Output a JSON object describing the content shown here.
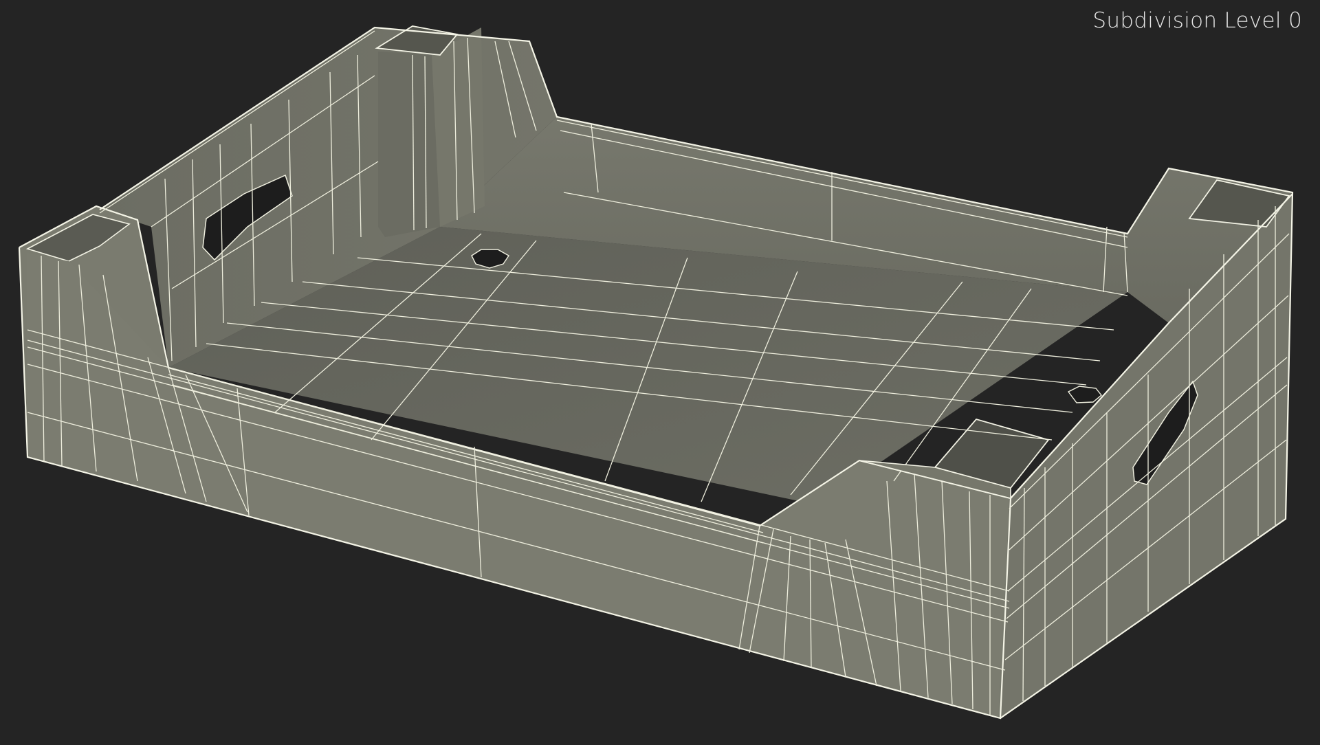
{
  "viewport": {
    "subdivision_label": "Subdivision Level 0"
  },
  "colors": {
    "background": "#242424",
    "wall_outer": "#77786c",
    "wall_inner": "#6f7065",
    "floor": "#66675d",
    "wireframe": "#eeeedd",
    "hole": "#1d1d1d"
  }
}
